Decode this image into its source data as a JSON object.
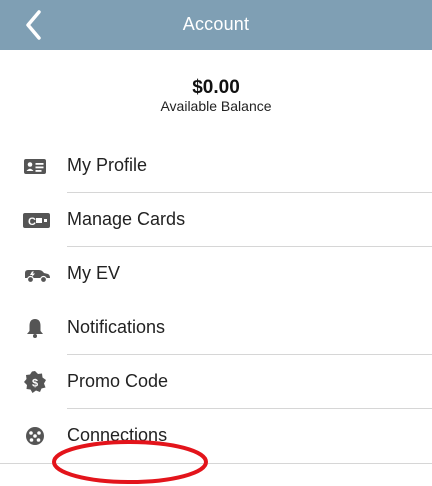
{
  "header": {
    "title": "Account",
    "back_icon": "chevron-left-icon",
    "background_color": "#7f9fb4"
  },
  "balance": {
    "amount": "$0.00",
    "label": "Available Balance"
  },
  "menu": {
    "items": [
      {
        "label": "My Profile",
        "icon": "id-card-icon"
      },
      {
        "label": "Manage Cards",
        "icon": "credit-card-icon"
      },
      {
        "label": "My EV",
        "icon": "ev-car-icon"
      },
      {
        "label": "Notifications",
        "icon": "bell-icon"
      },
      {
        "label": "Promo Code",
        "icon": "dollar-badge-icon"
      },
      {
        "label": "Connections",
        "icon": "connector-plug-icon"
      }
    ]
  },
  "annotation": {
    "shape": "ellipse",
    "color": "#e3141b"
  }
}
